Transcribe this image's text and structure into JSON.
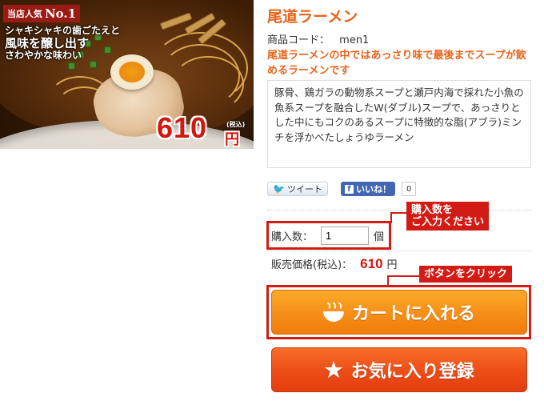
{
  "image": {
    "ribbon_small": "当店人気",
    "ribbon_big": "No.1",
    "catch_line1": "シャキシャキの歯ごたえと",
    "catch_line2": "風味を醸し出す",
    "catch_line3": "さわやかな味わい",
    "price": "610",
    "price_tax": "(税込)",
    "price_unit": "円"
  },
  "product": {
    "title": "尾道ラーメン",
    "code_label": "商品コード：",
    "code_value": "men1",
    "lead": "尾道ラーメンの中ではあっさり味で最後までスープが飲めるラーメンです",
    "description": "豚骨、鶏ガラの動物系スープと瀬戸内海で採れた小魚の魚系スープを融合したW(ダブル)スープで、あっさりとした中にもコクのあるスープに特徴的な脂(アブラ)ミンチを浮かべたしょうゆラーメン"
  },
  "social": {
    "tweet_label": "ツイート",
    "like_label": "いいね！",
    "like_count": "0"
  },
  "purchase": {
    "qty_label": "購入数：",
    "qty_value": "1",
    "qty_unit": "個",
    "price_label": "販売価格(税込)：",
    "price_value": "610",
    "price_unit": "円"
  },
  "callouts": {
    "qty_line1": "購入数を",
    "qty_line2": "ご入力ください",
    "cart": "ボタンをクリック"
  },
  "buttons": {
    "cart_label": "カートに入れる",
    "fav_label": "お気に入り登録"
  },
  "colors": {
    "accent_orange": "#e8641b",
    "price_red": "#d0180f",
    "callout_red": "#d11b14",
    "cart_button": "#f7901a",
    "fav_button": "#ee4f17"
  }
}
